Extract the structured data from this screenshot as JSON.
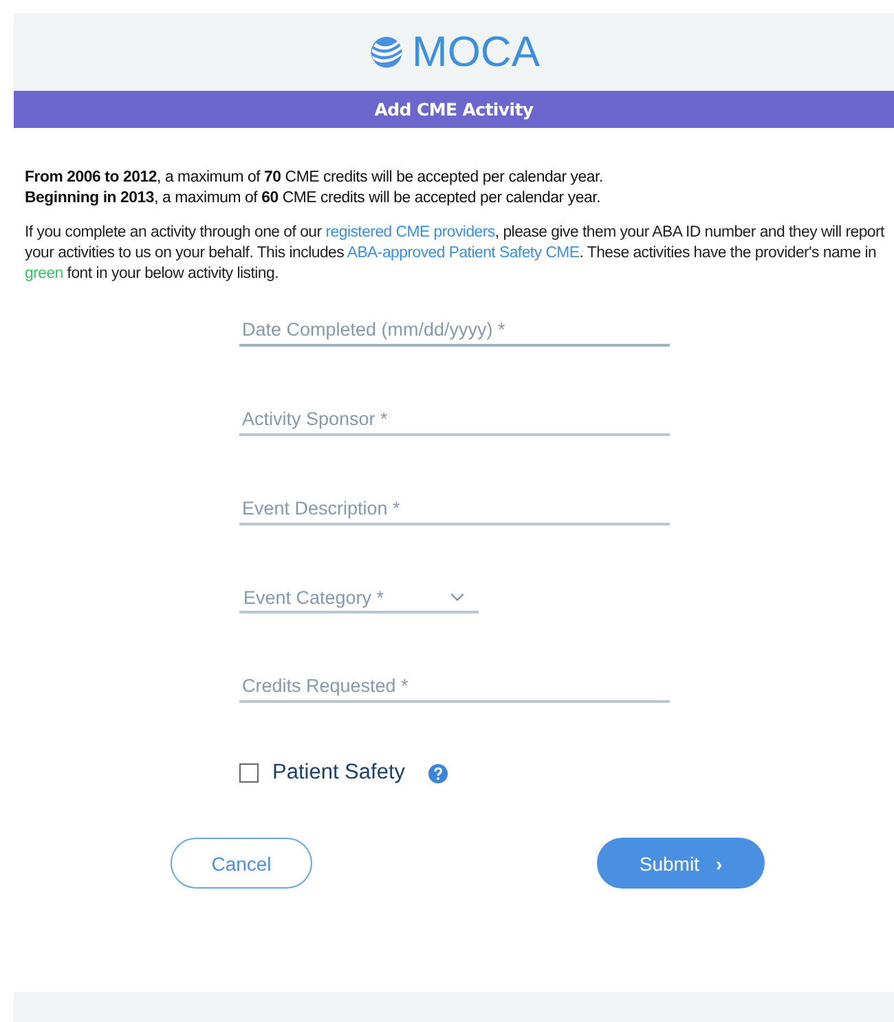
{
  "header": {
    "logo_text": "MOCA"
  },
  "title_bar": {
    "title": "Add CME Activity"
  },
  "limits": [
    "**From 2006 to 2012**, a maximum of **70** CME credits will be accepted per calendar year.",
    "**Beginning in 2013**, a maximum of **60** CME credits will be accepted per calendar year."
  ],
  "info": [
    {
      "kind": "text",
      "text": "If you complete an activity through one of our "
    },
    {
      "kind": "link",
      "text": "registered CME providers"
    },
    {
      "kind": "text",
      "text": ", please give them your ABA ID number and they will report your activities to us on your behalf. This includes "
    },
    {
      "kind": "link",
      "text": "ABA-approved Patient Safety CME"
    },
    {
      "kind": "text",
      "text": ". These activities have the provider's name in "
    },
    {
      "kind": "green",
      "text": "green"
    },
    {
      "kind": "text",
      "text": " font in your below activity listing."
    }
  ],
  "fields": [
    {
      "kind": "text",
      "placeholder": "Date Completed (mm/dd/yyyy) *"
    },
    {
      "kind": "text",
      "placeholder": "Activity Sponsor *"
    },
    {
      "kind": "text",
      "placeholder": "Event Description *"
    },
    {
      "kind": "select",
      "placeholder": "Event Category *"
    },
    {
      "kind": "text",
      "placeholder": "Credits Requested *"
    }
  ],
  "checkbox": {
    "label": "Patient Safety",
    "checked": false
  },
  "buttons": [
    {
      "kind": "secondary",
      "label": "Cancel"
    },
    {
      "kind": "primary",
      "label": "Submit",
      "chevron": "›"
    }
  ]
}
